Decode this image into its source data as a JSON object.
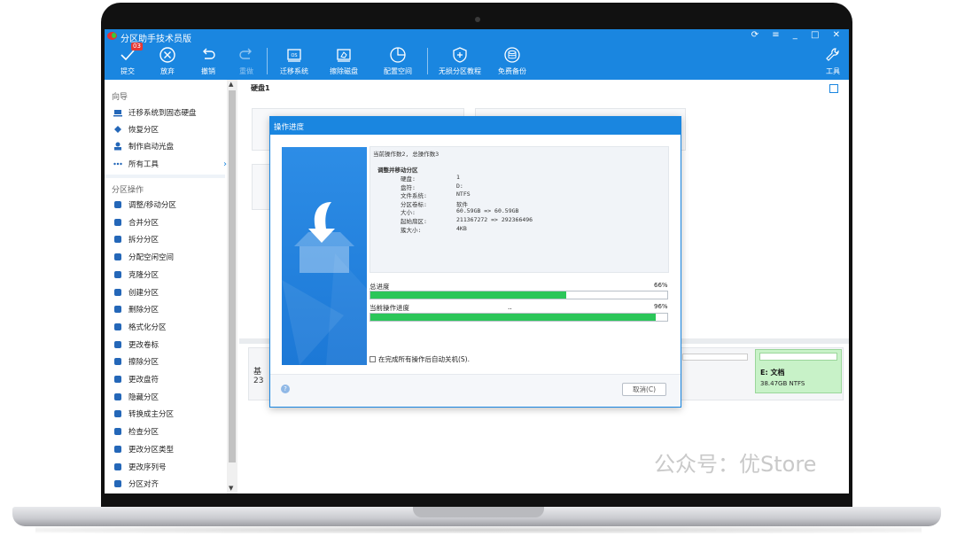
{
  "app": {
    "title": "分区助手技术员版",
    "window_controls": "⟳ ≡ _ □ ✕"
  },
  "toolbar": {
    "commit": {
      "label": "提交",
      "badge": "03"
    },
    "discard": {
      "label": "放弃"
    },
    "undo": {
      "label": "撤销"
    },
    "redo": {
      "label": "重做"
    },
    "migrate": {
      "label": "迁移系统"
    },
    "wipe": {
      "label": "擦除磁盘"
    },
    "allocate": {
      "label": "配置空间"
    },
    "tutorial": {
      "label": "无损分区教程"
    },
    "backup": {
      "label": "免费备份"
    },
    "tools": {
      "label": "工具"
    }
  },
  "sidebar": {
    "guide_header": "向导",
    "guide_items": [
      {
        "label": "迁移系统到固态硬盘",
        "icon": "ssd-icon"
      },
      {
        "label": "恢复分区",
        "icon": "recover-icon"
      },
      {
        "label": "制作启动光盘",
        "icon": "bootdisk-icon"
      },
      {
        "label": "所有工具",
        "icon": "more-icon"
      }
    ],
    "ops_header": "分区操作",
    "ops_items": [
      {
        "label": "调整/移动分区",
        "icon": "resize-icon"
      },
      {
        "label": "合并分区",
        "icon": "merge-icon"
      },
      {
        "label": "拆分分区",
        "icon": "split-icon"
      },
      {
        "label": "分配空闲空间",
        "icon": "allocate-icon"
      },
      {
        "label": "克隆分区",
        "icon": "clone-icon"
      },
      {
        "label": "创建分区",
        "icon": "create-icon"
      },
      {
        "label": "删除分区",
        "icon": "delete-icon"
      },
      {
        "label": "格式化分区",
        "icon": "format-icon"
      },
      {
        "label": "更改卷标",
        "icon": "label-icon"
      },
      {
        "label": "擦除分区",
        "icon": "wipe-icon"
      },
      {
        "label": "更改盘符",
        "icon": "letter-icon"
      },
      {
        "label": "隐藏分区",
        "icon": "hide-icon"
      },
      {
        "label": "转换成主分区",
        "icon": "convert-icon"
      },
      {
        "label": "检查分区",
        "icon": "check-icon"
      },
      {
        "label": "更改分区类型",
        "icon": "id-icon"
      },
      {
        "label": "更改序列号",
        "icon": "serial-icon"
      },
      {
        "label": "分区对齐",
        "icon": "align-icon"
      }
    ]
  },
  "main": {
    "disk1_label": "硬盘1",
    "disk2_text_1": "基",
    "disk2_text_2": "23",
    "partition_e": {
      "name": "E: 文档",
      "size": "38.47GB NTFS"
    }
  },
  "dialog": {
    "title": "操作进度",
    "header_line": "当前操作数2, 总操作数3",
    "operation": "调整并移动分区",
    "details": [
      {
        "key": "硬盘:",
        "value": "1"
      },
      {
        "key": "盘符:",
        "value": "D:"
      },
      {
        "key": "文件系统:",
        "value": "NTFS"
      },
      {
        "key": "分区卷标:",
        "value": "软件"
      },
      {
        "key": "大小:",
        "value": "60.59GB => 60.59GB"
      },
      {
        "key": "起始扇区:",
        "value": "211367272 => 292366496"
      },
      {
        "key": "簇大小:",
        "value": "4KB"
      }
    ],
    "total_progress": {
      "label": "总进度",
      "percent_text": "66%",
      "value": 0.66
    },
    "current_progress": {
      "label": "当前操作进度",
      "dots": "..",
      "percent_text": "96%",
      "value": 0.96
    },
    "shutdown_checkbox": "在完成所有操作后自动关机(S).",
    "cancel_button": "取消(C)"
  },
  "watermark": "公众号：优Store",
  "colors": {
    "accent": "#1a86e0",
    "progress": "#2bc659",
    "partition_e": "#c8f2c8"
  }
}
